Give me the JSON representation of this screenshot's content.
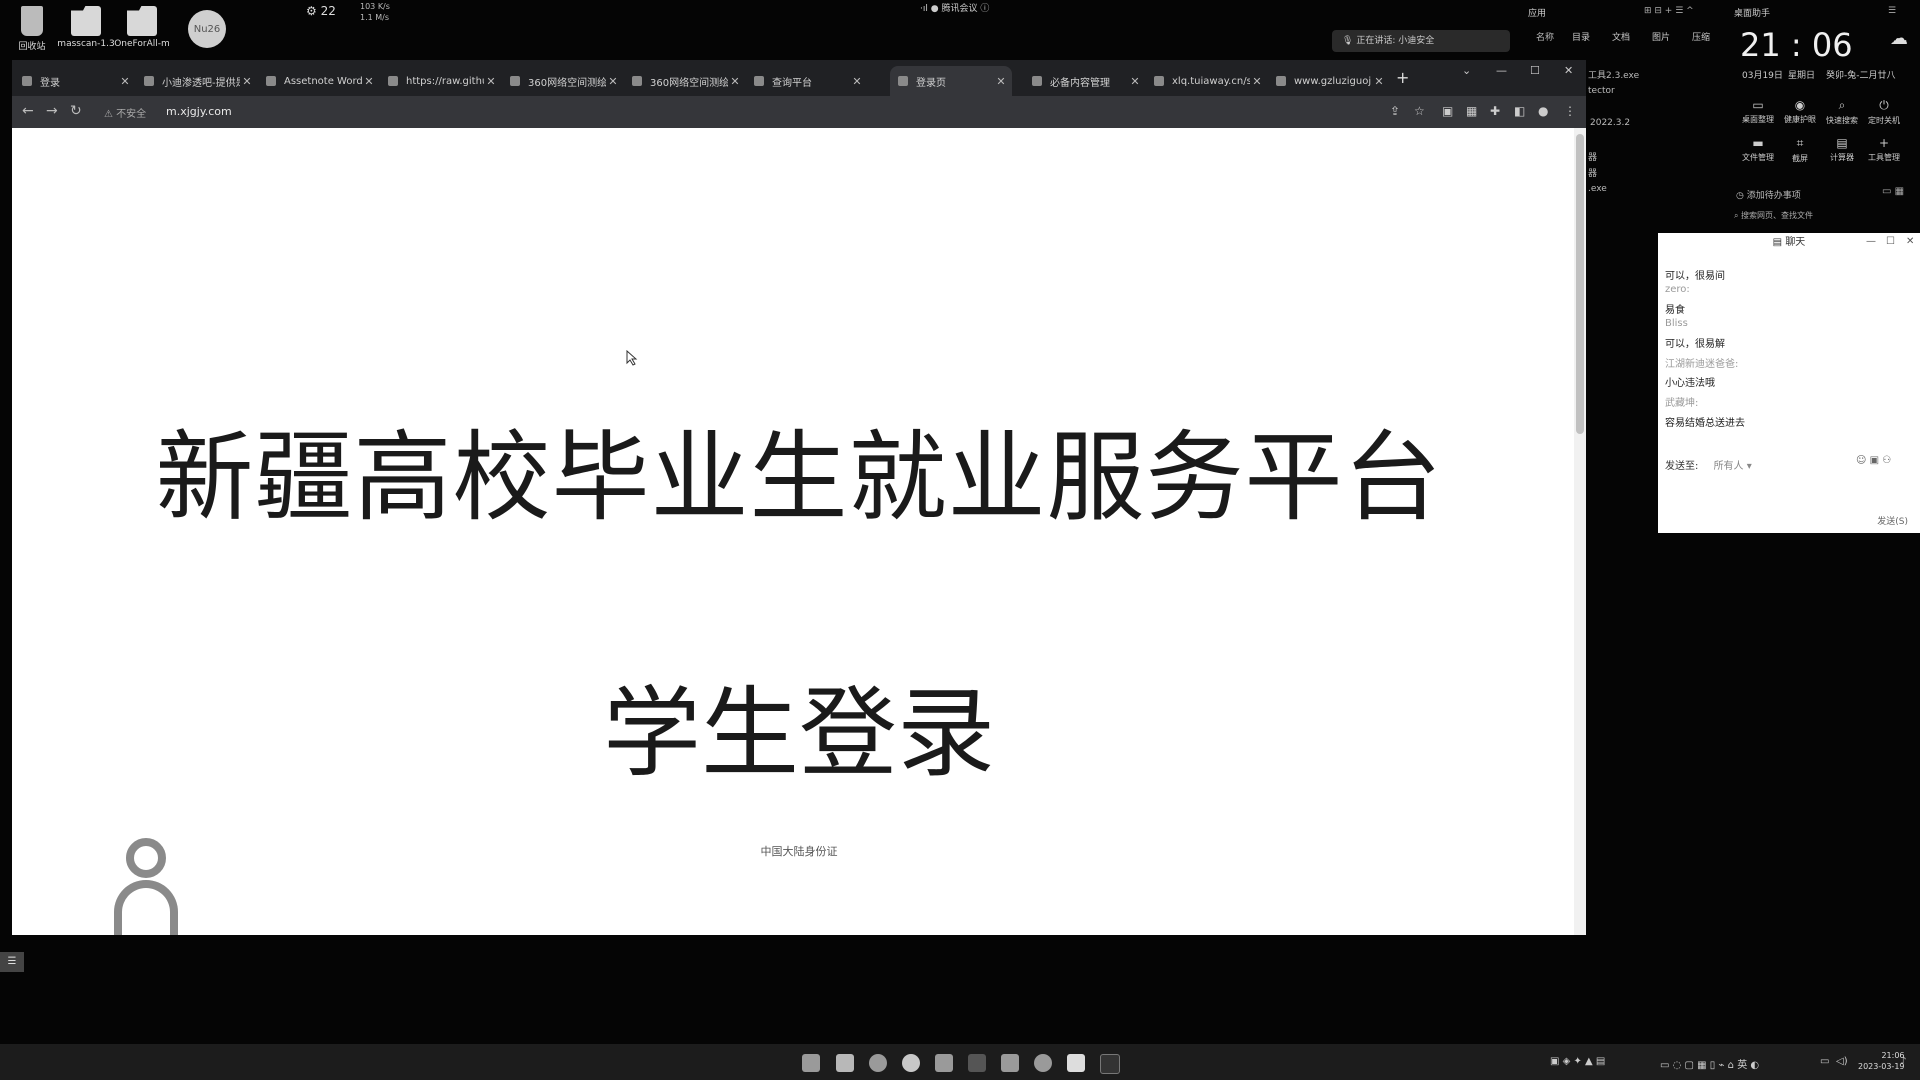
{
  "desktop": {
    "icons": [
      {
        "label": "回收站"
      },
      {
        "label": "masscan-1.3"
      },
      {
        "label": "OneForAll-m"
      }
    ],
    "avatar_text": "Nu26",
    "weather": "22",
    "net_speed": [
      "103 K/s",
      "1.1 M/s"
    ],
    "meeting_label": "腾讯会议",
    "voice_banner": "正在讲话: 小迪安全"
  },
  "browser": {
    "tabs": [
      {
        "label": "登录",
        "active": false
      },
      {
        "label": "小迪渗透吧-提供是",
        "active": false
      },
      {
        "label": "Assetnote Wordli",
        "active": false
      },
      {
        "label": "https://raw.githu",
        "active": false
      },
      {
        "label": "360网络空间测绘",
        "active": false
      },
      {
        "label": "360网络空间测绘",
        "active": false
      },
      {
        "label": "查询平台",
        "active": false
      },
      {
        "label": "登录页",
        "active": true
      },
      {
        "label": "必备内容管理",
        "active": false
      },
      {
        "label": "xlq.tuiaway.cn/sy",
        "active": false
      },
      {
        "label": "www.gzluziguoji",
        "active": false
      }
    ],
    "security_label": "不安全",
    "url": "m.xjgjy.com",
    "page": {
      "title": "新疆高校毕业生就业服务平台",
      "subtitle": "学生登录",
      "footer_link": "中国大陆身份证"
    }
  },
  "background_window": {
    "texts": [
      "工具2.3.exe",
      "tector",
      "2022.3.2",
      "器",
      "器",
      ".exe"
    ]
  },
  "widget": {
    "top_menu": [
      "应用",
      "桌面助手"
    ],
    "categories": [
      "名称",
      "目录",
      "文档",
      "图片",
      "压缩"
    ],
    "time": "21 : 06",
    "date": "03月19日",
    "weekday": "星期日",
    "lunar": "癸卯-兔-二月廿八",
    "tools_row1": [
      "桌面整理",
      "健康护眼",
      "快速搜索",
      "定时关机"
    ],
    "tools_row2": [
      "文件管理",
      "截屏",
      "计算器",
      "工具管理"
    ],
    "todo": "添加待办事项",
    "search_placeholder": "搜索网页、查找文件"
  },
  "chat": {
    "title": "聊天",
    "messages": [
      {
        "text": "可以，很易间",
        "muted": false
      },
      {
        "text": "zero:",
        "muted": true
      },
      {
        "text": "易食",
        "muted": false
      },
      {
        "text": "Bliss",
        "muted": true
      },
      {
        "text": "可以，很易解",
        "muted": false
      },
      {
        "text": "江湖新迪迷爸爸:",
        "muted": true
      },
      {
        "text": "小心违法哦",
        "muted": false
      },
      {
        "text": "武藏坤:",
        "muted": true
      },
      {
        "text": "容易结婚总送进去",
        "muted": false
      }
    ],
    "send_to_label": "发送至:",
    "send_to_value": "所有人",
    "send_button": "发送(S)"
  },
  "taskbar": {
    "clock_time": "21:06",
    "clock_date": "2023-03-19"
  }
}
